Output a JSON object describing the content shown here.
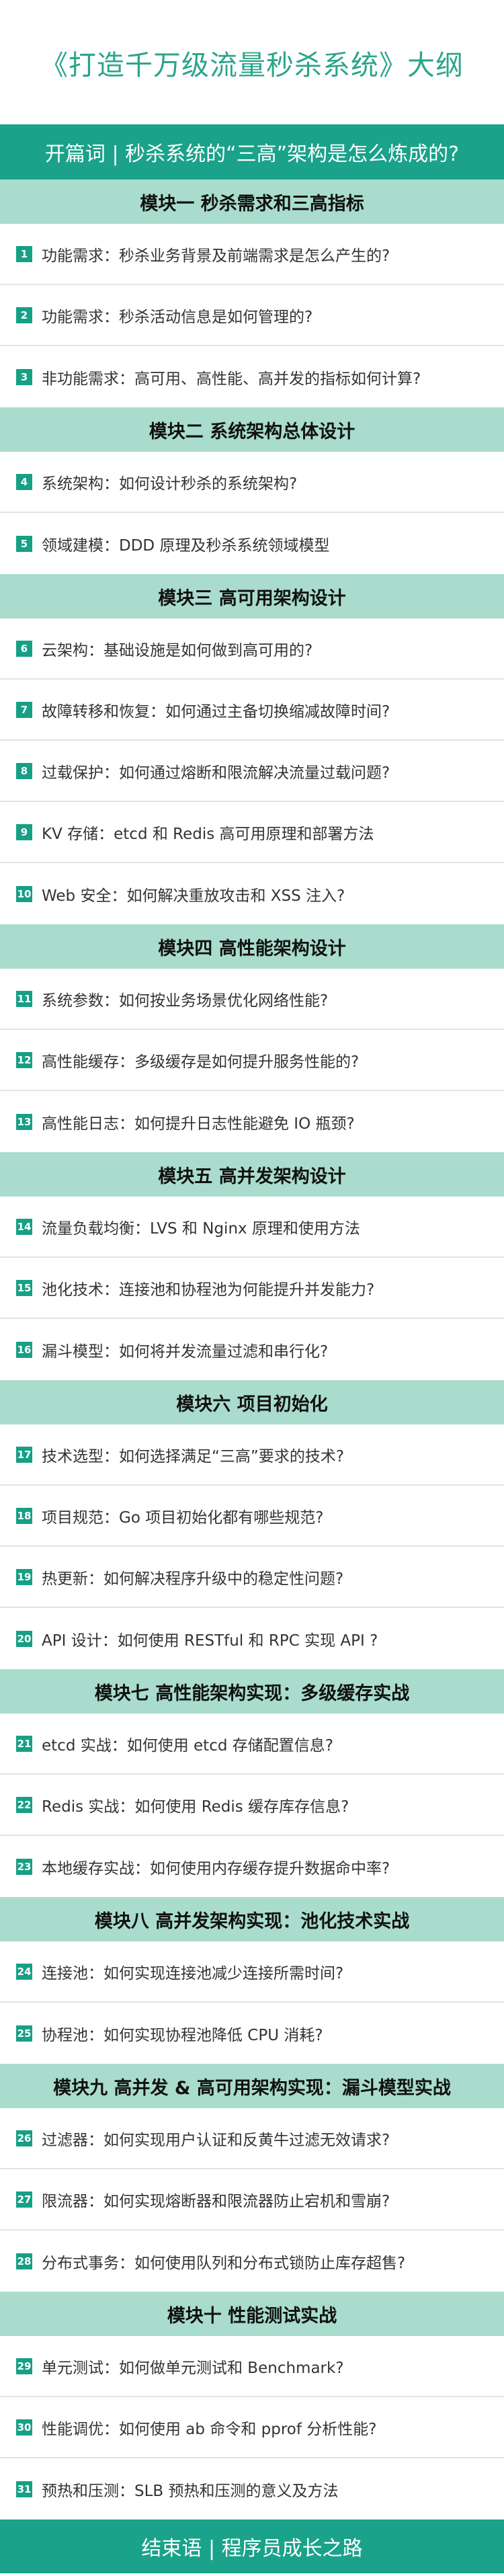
{
  "title": "《打造千万级流量秒杀系统》大纲",
  "opening": "开篇词 | 秒杀系统的“三高”架构是怎么炼成的?",
  "modules": [
    {
      "title": "模块一 秒杀需求和三高指标",
      "items": [
        {
          "num": "1",
          "text": "功能需求：秒杀业务背景及前端需求是怎么产生的?"
        },
        {
          "num": "2",
          "text": "功能需求：秒杀活动信息是如何管理的?"
        },
        {
          "num": "3",
          "text": "非功能需求：高可用、高性能、高并发的指标如何计算?"
        }
      ]
    },
    {
      "title": "模块二 系统架构总体设计",
      "items": [
        {
          "num": "4",
          "text": "系统架构：如何设计秒杀的系统架构?"
        },
        {
          "num": "5",
          "text": "领域建模：DDD 原理及秒杀系统领域模型"
        }
      ]
    },
    {
      "title": "模块三 高可用架构设计",
      "items": [
        {
          "num": "6",
          "text": "云架构：基础设施是如何做到高可用的?"
        },
        {
          "num": "7",
          "text": "故障转移和恢复：如何通过主备切换缩减故障时间?"
        },
        {
          "num": "8",
          "text": "过载保护：如何通过熔断和限流解决流量过载问题?"
        },
        {
          "num": "9",
          "text": "KV 存储：etcd 和 Redis 高可用原理和部署方法"
        },
        {
          "num": "10",
          "text": "Web 安全：如何解决重放攻击和 XSS 注入?"
        }
      ]
    },
    {
      "title": "模块四 高性能架构设计",
      "items": [
        {
          "num": "11",
          "text": "系统参数：如何按业务场景优化网络性能?"
        },
        {
          "num": "12",
          "text": "高性能缓存：多级缓存是如何提升服务性能的?"
        },
        {
          "num": "13",
          "text": "高性能日志：如何提升日志性能避免 IO 瓶颈?"
        }
      ]
    },
    {
      "title": "模块五 高并发架构设计",
      "items": [
        {
          "num": "14",
          "text": "流量负载均衡：LVS 和 Nginx 原理和使用方法"
        },
        {
          "num": "15",
          "text": "池化技术：连接池和协程池为何能提升并发能力?"
        },
        {
          "num": "16",
          "text": "漏斗模型：如何将并发流量过滤和串行化?"
        }
      ]
    },
    {
      "title": "模块六 项目初始化",
      "items": [
        {
          "num": "17",
          "text": "技术选型：如何选择满足“三高”要求的技术?"
        },
        {
          "num": "18",
          "text": "项目规范：Go 项目初始化都有哪些规范?"
        },
        {
          "num": "19",
          "text": "热更新：如何解决程序升级中的稳定性问题?"
        },
        {
          "num": "20",
          "text": "API 设计：如何使用 RESTful 和 RPC 实现 API ?"
        }
      ]
    },
    {
      "title": "模块七 高性能架构实现：多级缓存实战",
      "items": [
        {
          "num": "21",
          "text": "etcd 实战：如何使用 etcd 存储配置信息?"
        },
        {
          "num": "22",
          "text": "Redis 实战：如何使用 Redis 缓存库存信息?"
        },
        {
          "num": "23",
          "text": "本地缓存实战：如何使用内存缓存提升数据命中率?"
        }
      ]
    },
    {
      "title": "模块八 高并发架构实现：池化技术实战",
      "items": [
        {
          "num": "24",
          "text": "连接池：如何实现连接池减少连接所需时间?"
        },
        {
          "num": "25",
          "text": "协程池：如何实现协程池降低 CPU 消耗?"
        }
      ]
    },
    {
      "title": "模块九 高并发 & 高可用架构实现：漏斗模型实战",
      "items": [
        {
          "num": "26",
          "text": "过滤器：如何实现用户认证和反黄牛过滤无效请求?"
        },
        {
          "num": "27",
          "text": "限流器：如何实现熔断器和限流器防止宕机和雪崩?"
        },
        {
          "num": "28",
          "text": "分布式事务：如何使用队列和分布式锁防止库存超售?"
        }
      ]
    },
    {
      "title": "模块十 性能测试实战",
      "items": [
        {
          "num": "29",
          "text": "单元测试：如何做单元测试和 Benchmark?"
        },
        {
          "num": "30",
          "text": "性能调优：如何使用 ab 命令和 pprof 分析性能?"
        },
        {
          "num": "31",
          "text": "预热和压测：SLB 预热和压测的意义及方法"
        }
      ]
    }
  ],
  "closing": "结束语 | 程序员成长之路",
  "colors": {
    "accent": "#1aa28a",
    "title": "#2ba58b",
    "module_bg": "#a9dccd",
    "badge": "#16a085"
  }
}
